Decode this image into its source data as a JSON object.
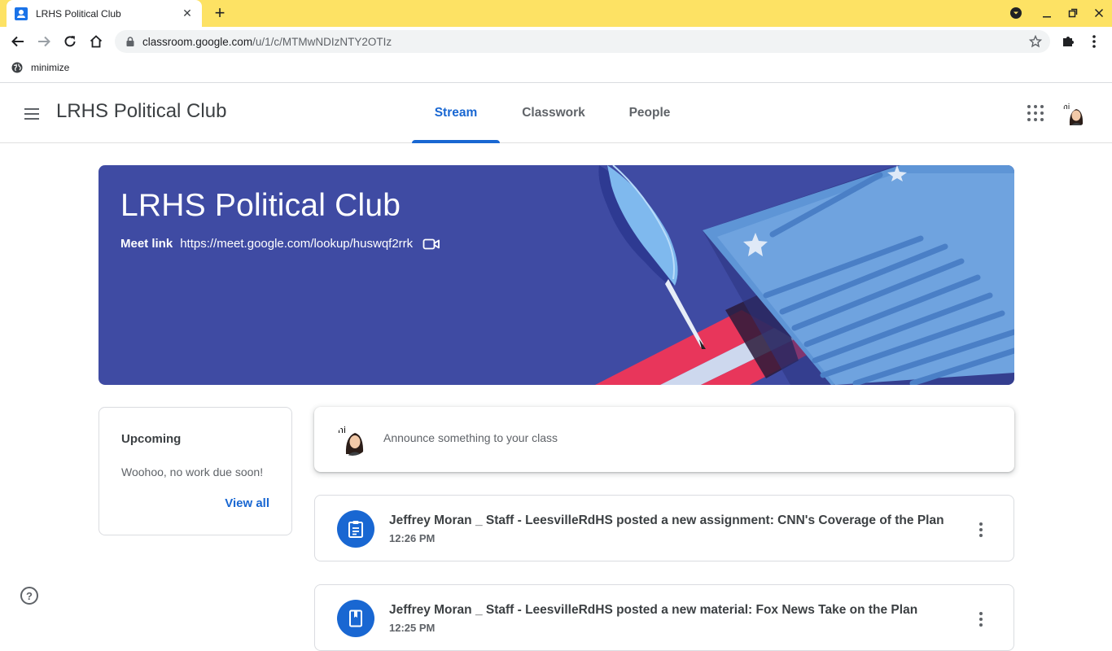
{
  "browser": {
    "tab_title": "LRHS Political Club",
    "new_tab_symbol": "+",
    "url_host": "classroom.google.com",
    "url_path": "/u/1/c/MTMwNDIzNTY2OTIz",
    "bookmark_label": "minimize"
  },
  "header": {
    "class_name": "LRHS Political Club",
    "tabs": [
      {
        "label": "Stream",
        "active": true
      },
      {
        "label": "Classwork",
        "active": false
      },
      {
        "label": "People",
        "active": false
      }
    ]
  },
  "banner": {
    "title": "LRHS Political Club",
    "meet_label": "Meet link",
    "meet_url": "https://meet.google.com/lookup/huswqf2rrk",
    "color": "#3f4ba3"
  },
  "upcoming": {
    "title": "Upcoming",
    "message": "Woohoo, no work due soon!",
    "view_all": "View all"
  },
  "announce": {
    "placeholder": "Announce something to your class"
  },
  "posts": [
    {
      "text": "Jeffrey Moran _ Staff - LeesvilleRdHS posted a new assignment: CNN's Coverage of the Plan",
      "time": "12:26 PM",
      "icon": "assignment-icon"
    },
    {
      "text": "Jeffrey Moran _ Staff - LeesvilleRdHS posted a new material: Fox News Take on the Plan",
      "time": "12:25 PM",
      "icon": "material-icon"
    }
  ],
  "help_symbol": "?",
  "colors": {
    "accent": "#1967d2",
    "tabstrip": "#fde264"
  }
}
